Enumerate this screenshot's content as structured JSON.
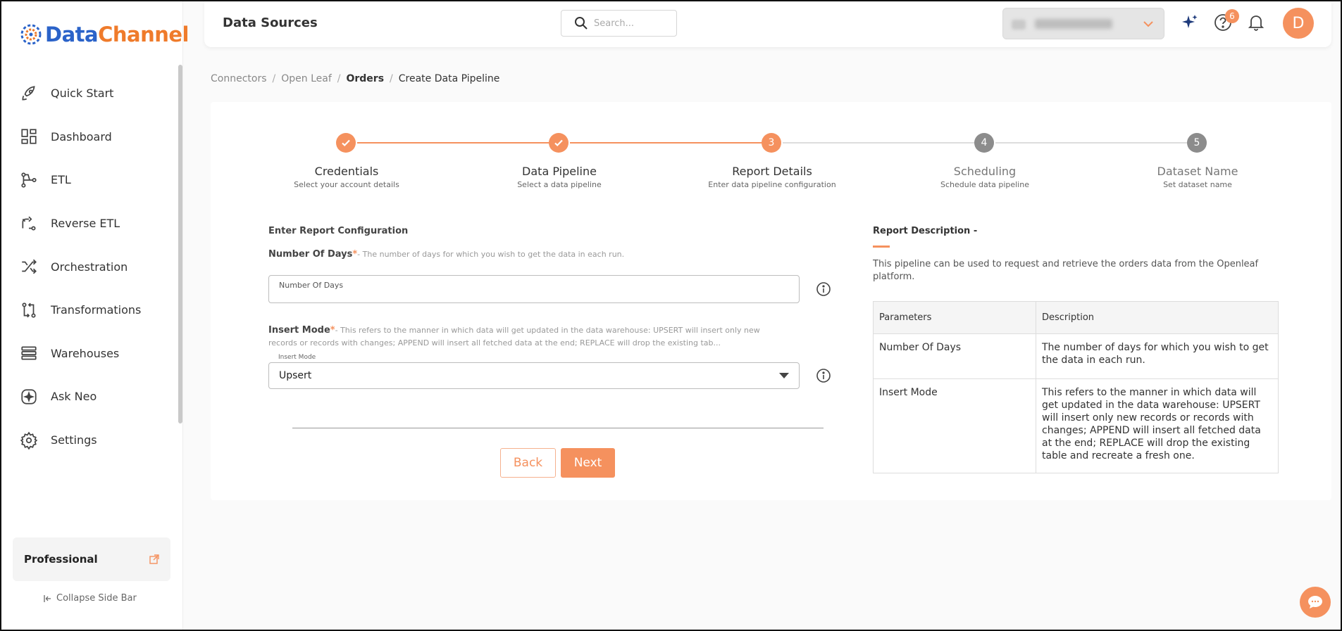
{
  "brand": {
    "part1": "Data",
    "part2": "Channel"
  },
  "sidebar": {
    "items": [
      {
        "label": "Quick Start",
        "icon": "rocket-icon"
      },
      {
        "label": "Dashboard",
        "icon": "dashboard-icon"
      },
      {
        "label": "ETL",
        "icon": "etl-icon"
      },
      {
        "label": "Reverse ETL",
        "icon": "reverse-etl-icon"
      },
      {
        "label": "Orchestration",
        "icon": "orchestration-icon"
      },
      {
        "label": "Transformations",
        "icon": "transformations-icon"
      },
      {
        "label": "Warehouses",
        "icon": "warehouses-icon"
      },
      {
        "label": "Ask Neo",
        "icon": "ask-neo-icon"
      },
      {
        "label": "Settings",
        "icon": "gear-icon"
      }
    ],
    "plan": "Professional",
    "collapse_label": "Collapse Side Bar"
  },
  "header": {
    "title": "Data Sources",
    "search_placeholder": "Search...",
    "notification_count": "6",
    "avatar_initial": "D"
  },
  "breadcrumb": [
    "Connectors",
    "Open Leaf",
    "Orders",
    "Create Data Pipeline"
  ],
  "stepper": [
    {
      "num": "1",
      "title": "Credentials",
      "sub": "Select your account details",
      "state": "done"
    },
    {
      "num": "2",
      "title": "Data Pipeline",
      "sub": "Select a data pipeline",
      "state": "done"
    },
    {
      "num": "3",
      "title": "Report Details",
      "sub": "Enter data pipeline configuration",
      "state": "active"
    },
    {
      "num": "4",
      "title": "Scheduling",
      "sub": "Schedule data pipeline",
      "state": "todo"
    },
    {
      "num": "5",
      "title": "Dataset Name",
      "sub": "Set dataset name",
      "state": "todo"
    }
  ],
  "form": {
    "section_title": "Enter Report Configuration",
    "days_label": "Number Of Days",
    "required_mark": "*",
    "days_help": "- The number of days for which you wish to get the data in each run.",
    "days_placeholder": "Number Of Days",
    "mode_label": "Insert Mode",
    "mode_help": "- This refers to the manner in which data will get updated in the data warehouse: UPSERT will insert only new records or records with changes; APPEND will insert all fetched data at the end; REPLACE will drop the existing tab...",
    "mode_float_label": "Insert Mode",
    "mode_value": "Upsert",
    "back_label": "Back",
    "next_label": "Next"
  },
  "description": {
    "title": "Report Description -",
    "text": "This pipeline can be used to request and retrieve the orders data from the Openleaf platform.",
    "table_headers": [
      "Parameters",
      "Description"
    ],
    "rows": [
      [
        "Number Of Days",
        "The number of days for which you wish to get the data in each run."
      ],
      [
        "Insert Mode",
        "This refers to the manner in which data will get updated in the data warehouse: UPSERT will insert only new records or records with changes; APPEND will insert all fetched data at the end; REPLACE will drop the existing table and recreate a fresh one."
      ]
    ]
  },
  "colors": {
    "accent": "#f5915e",
    "inactive_step": "#8c8c8c",
    "brand_blue": "#2b63c9",
    "brand_orange": "#ef7b2b"
  }
}
